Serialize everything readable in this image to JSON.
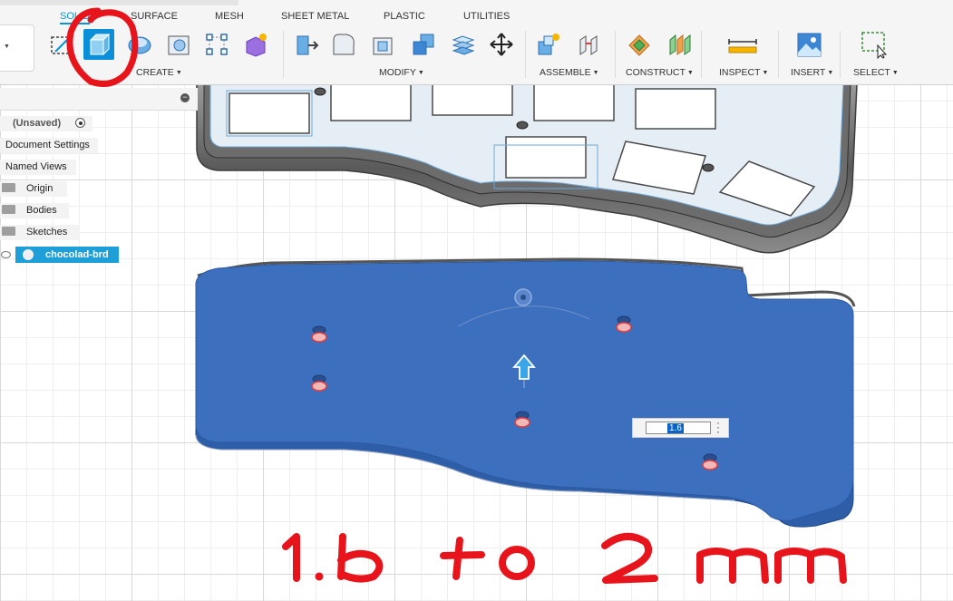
{
  "toolbar": {
    "tabs": [
      "SOLID",
      "SURFACE",
      "MESH",
      "SHEET METAL",
      "PLASTIC",
      "UTILITIES"
    ],
    "active_tab": "SOLID",
    "groups": [
      "CREATE",
      "MODIFY",
      "ASSEMBLE",
      "CONSTRUCT",
      "INSPECT",
      "INSERT",
      "SELECT"
    ],
    "tools": [
      "create-sketch-icon",
      "extrude-icon",
      "revolve-icon",
      "hole-icon",
      "pattern-icon",
      "form-icon",
      "press-pull-icon",
      "fillet-icon",
      "shell-icon",
      "combine-icon",
      "scale-icon",
      "move-icon",
      "new-component-icon",
      "joint-icon",
      "offset-plane-icon",
      "midplane-icon",
      "measure-icon",
      "insert-image-icon",
      "select-icon"
    ],
    "selected_tool": "extrude-icon"
  },
  "browser": {
    "document_name": "(Unsaved)",
    "items": [
      "Document Settings",
      "Named Views",
      "Origin",
      "Bodies",
      "Sketches"
    ],
    "component": "chocolad-brd"
  },
  "extrude_input": {
    "value": "1.6"
  },
  "annotation": {
    "handwritten_text": "1.6 to 2 mm",
    "color": "#e8141c"
  },
  "colors": {
    "accent": "#0696d7",
    "selected_face": "#3d6fbf",
    "body_gray": "#7d7d7d"
  }
}
